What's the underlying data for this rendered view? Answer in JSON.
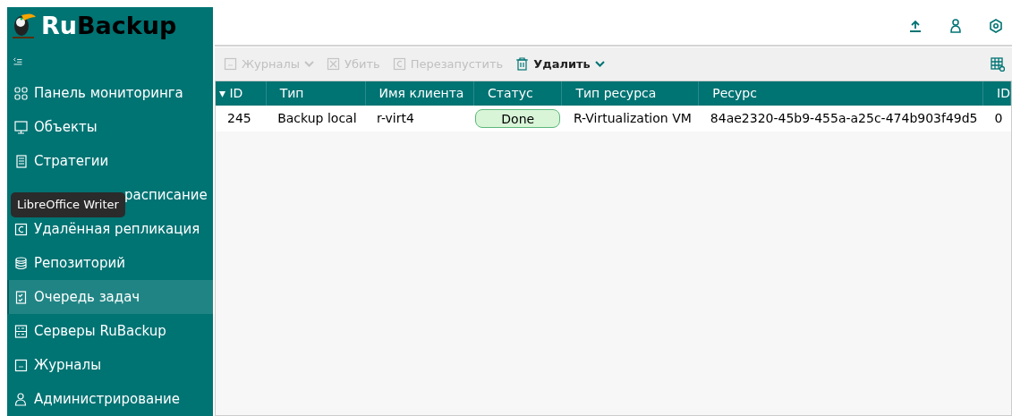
{
  "logo": {
    "text_a": "Ru",
    "text_b": "Backup"
  },
  "sidebar": {
    "items": [
      {
        "label": "Панель мониторинга",
        "selected": false
      },
      {
        "label": "Объекты",
        "selected": false
      },
      {
        "label": "Стратегии",
        "selected": false
      },
      {
        "label": "расписание",
        "selected": false
      },
      {
        "label": "Удалённая репликация",
        "selected": false
      },
      {
        "label": "Репозиторий",
        "selected": false
      },
      {
        "label": "Очередь задач",
        "selected": true
      },
      {
        "label": "Серверы RuBackup",
        "selected": false
      },
      {
        "label": "Журналы",
        "selected": false
      },
      {
        "label": "Администрирование",
        "selected": false
      }
    ]
  },
  "tooltip": "LibreOffice Writer",
  "toolbar": [
    {
      "label": "Журналы",
      "disabled": true,
      "dropdown": true
    },
    {
      "label": "Убить",
      "disabled": true,
      "dropdown": false
    },
    {
      "label": "Перезапустить",
      "disabled": true,
      "dropdown": false
    },
    {
      "label": "Удалить",
      "disabled": false,
      "dropdown": true
    }
  ],
  "table": {
    "columns": [
      "ID",
      "Тип",
      "Имя клиента",
      "Статус",
      "Тип ресурса",
      "Ресурс",
      "ID"
    ],
    "sort_mark": "▾",
    "rows": [
      {
        "cells": [
          "245",
          "Backup local",
          "r-virt4",
          "Done",
          "R-Virtualization VM",
          "84ae2320-45b9-455a-a25c-474b903f49d5",
          "0"
        ]
      }
    ]
  }
}
